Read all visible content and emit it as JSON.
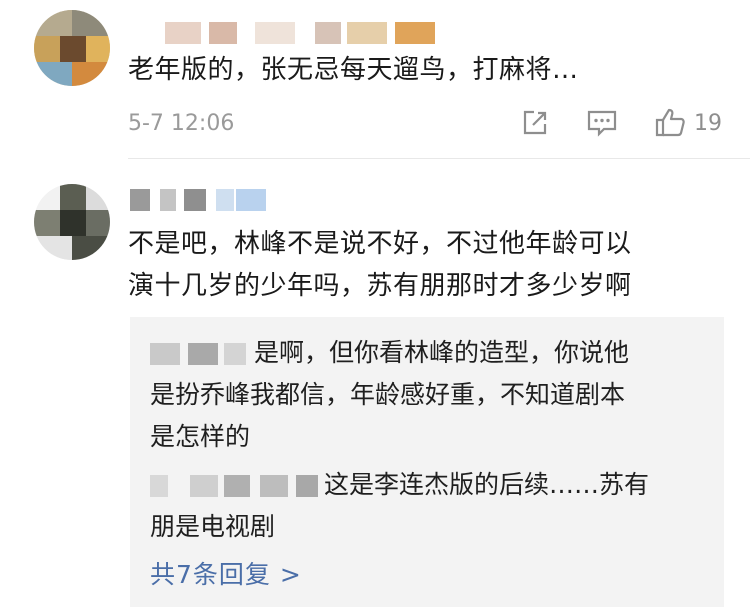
{
  "comments": [
    {
      "text_lines": [
        "老年版的，张无忌每天遛鸟，打麻将…"
      ],
      "time": "5-7 12:06",
      "like_count": "19"
    },
    {
      "text_lines": [
        "不是吧，林峰不是说不好，不过他年龄可以",
        "演十几岁的少年吗，苏有朋那时才多少岁啊"
      ],
      "replies": [
        {
          "lines": [
            "是啊，但你看林峰的造型，你说他",
            "是扮乔峰我都信，年龄感好重，不知道剧本",
            "是怎样的"
          ]
        },
        {
          "lines": [
            "这是李连杰版的后续……苏有",
            "朋是电视剧"
          ]
        }
      ],
      "more_replies_label": "共7条回复 >"
    }
  ],
  "icons": {
    "share": "share-icon",
    "comment": "comment-icon",
    "like": "thumbs-up-icon"
  },
  "colors": {
    "meta_gray": "#9a9a9a",
    "link_blue": "#4a6ea8",
    "reply_bg": "#f3f3f3"
  }
}
